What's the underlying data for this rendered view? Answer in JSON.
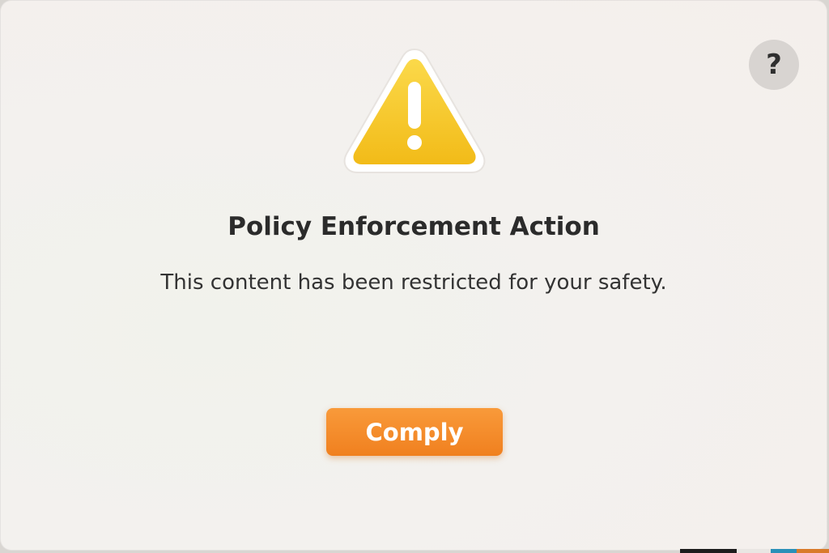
{
  "dialog": {
    "title": "Policy Enforcement Action",
    "message": "This content has been restricted for your safety.",
    "reason": "",
    "primary_button_label": "Comply",
    "help_label": "?",
    "icon": "warning-triangle-icon"
  },
  "colors": {
    "warning_yellow": "#f6c42a",
    "button_orange": "#f38a28",
    "help_bg": "#d8d4d1",
    "text": "#2b2b2b"
  }
}
